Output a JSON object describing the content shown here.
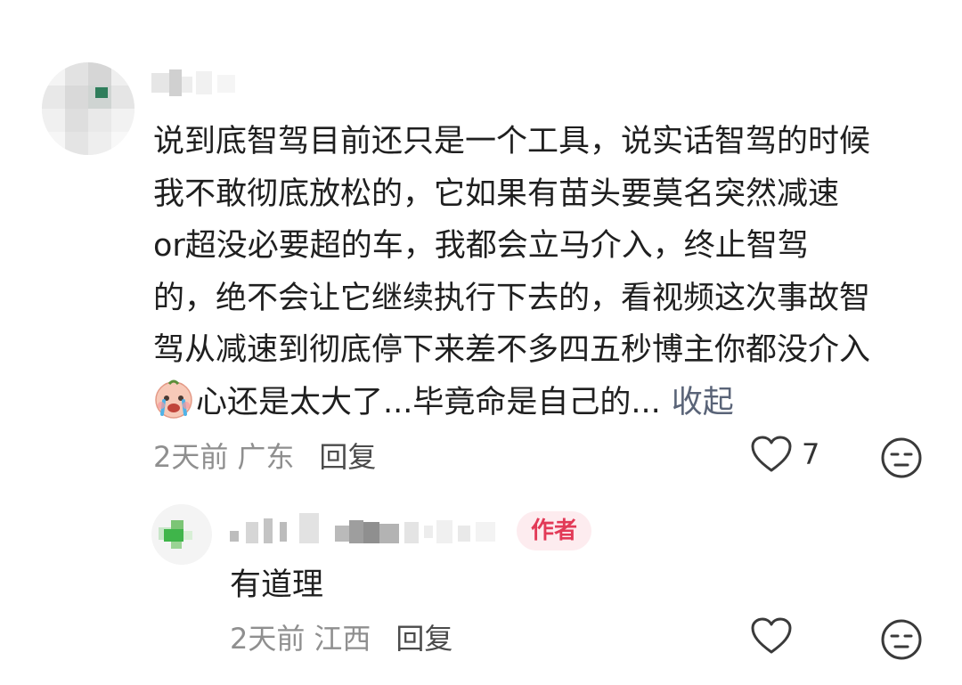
{
  "comment": {
    "lines": [
      "说到底智驾目前还只是一个工具，说实话智驾的时候",
      "我不敢彻底放松的，它如果有苗头要莫名突然减速",
      "or超没必要超的车，我都会立马介入，终止智驾",
      "的，绝不会让它继续执行下去的，看视频这次事故智",
      "驾从减速到彻底停下来差不多四五秒博主你都没介入"
    ],
    "last_line": "心还是太大了...毕竟命是自己的...",
    "collapse_label": "收起",
    "emoji_icon": "crying-face-icon",
    "time": "2天前",
    "region": "广东",
    "reply_label": "回复",
    "like_count": "7"
  },
  "reply": {
    "author_badge": "作者",
    "text": "有道理",
    "time": "2天前",
    "region": "江西",
    "reply_label": "回复"
  },
  "colors": {
    "badge_text": "#e23a57",
    "badge_bg": "#fdecef",
    "meta_gray": "#8f8f8f",
    "link_gray": "#5a6478"
  }
}
